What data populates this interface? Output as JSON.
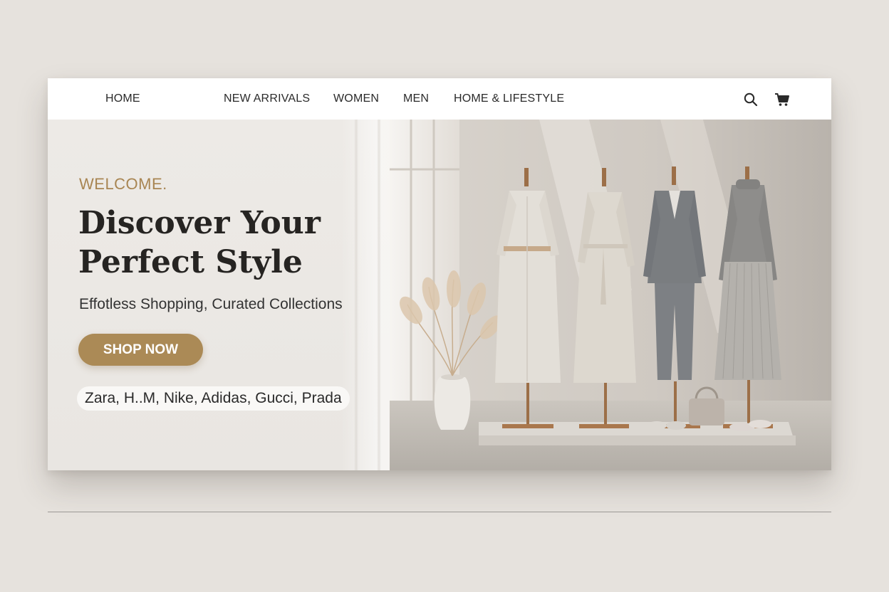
{
  "nav": {
    "items": [
      {
        "label": "HOME"
      },
      {
        "label": "NEW ARRIVALS"
      },
      {
        "label": "WOMEN"
      },
      {
        "label": "MEN"
      },
      {
        "label": "HOME & LIFESTYLE"
      }
    ],
    "icons": [
      "search-icon",
      "cart-icon"
    ]
  },
  "hero": {
    "eyebrow": "WELCOME.",
    "headline_line1": "Discover Your",
    "headline_line2": "Perfect Style",
    "subheadline": "Effotless Shopping, Curated Collections",
    "cta_label": "SHOP NOW",
    "brands": "Zara, H..M, Nike, Adidas, Gucci, Prada",
    "image": "showroom photo: four mannequins in neutral dresses, suit and knitwear, pampas grass vase, handbag and sneakers on a platform"
  },
  "colors": {
    "accent": "#ab8a56",
    "eyebrow": "#a88552",
    "background": "#e6e2dd",
    "panel": "#edeae6",
    "text": "#262422"
  }
}
